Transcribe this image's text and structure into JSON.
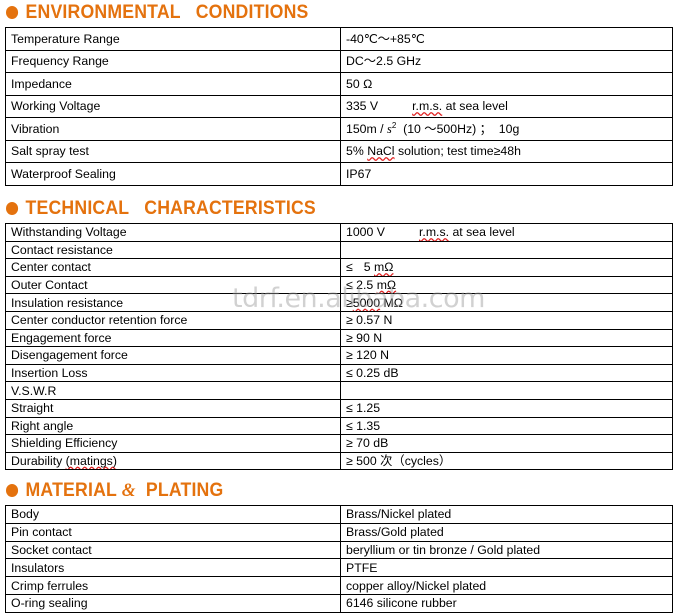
{
  "colors": {
    "accent": "#E4720E",
    "text": "#000000",
    "border": "#000000",
    "watermark": "#9b9b9b",
    "spellcheck": "#e02020"
  },
  "watermark": {
    "text": "tdrf.en.alibaba.com"
  },
  "sections": [
    {
      "id": "environmental-conditions",
      "heading": "ENVIRONMENTAL   CONDITIONS",
      "rows": [
        {
          "label": "Temperature Range",
          "value": "-40℃〜+85℃"
        },
        {
          "label": "Frequency Range",
          "value": "DC〜2.5 GHz"
        },
        {
          "label": "Impedance",
          "value": "50 Ω"
        },
        {
          "label": "Working Voltage",
          "value": "335 V"
        },
        {
          "label": "Vibration",
          "value": "150m / s2  (10 〜500Hz) ；  10g"
        },
        {
          "label": "Salt spray test",
          "value": "5% NaCl solution; test time≥48h"
        },
        {
          "label": "Waterproof Sealing",
          "value": "IP67"
        }
      ],
      "notes": {
        "working_voltage_suffix": "r.m.s. at sea level",
        "working_voltage_rms": "r.m.s.",
        "working_voltage_tail": " at sea level"
      }
    },
    {
      "id": "technical-characteristics",
      "heading": "TECHNICAL   CHARACTERISTICS",
      "rows": [
        {
          "label": "Withstanding Voltage",
          "value": "1000 V"
        },
        {
          "label": "Contact resistance",
          "value": ""
        },
        {
          "label": "Center contact",
          "value": "≤   5 mΩ"
        },
        {
          "label": "Outer Contact",
          "value": "≤ 2.5 mΩ"
        },
        {
          "label": "Insulation resistance",
          "value": "≥5000 MΩ"
        },
        {
          "label": "Center conductor retention force",
          "value": "≥ 0.57 N"
        },
        {
          "label": "Engagement force",
          "value": "≥ 90 N"
        },
        {
          "label": "Disengagement force",
          "value": "≥ 120 N"
        },
        {
          "label": "Insertion Loss",
          "value": "≤ 0.25 dB"
        },
        {
          "label": "V.S.W.R",
          "value": ""
        },
        {
          "label": "Straight",
          "value": "≤ 1.25"
        },
        {
          "label": "Right angle",
          "value": "≤ 1.35"
        },
        {
          "label": "Shielding Efficiency",
          "value": "≥ 70 dB"
        },
        {
          "label": "Durability (matings)",
          "value": "≥ 500 次（cycles）"
        }
      ],
      "notes": {
        "withstanding_voltage_rms": "r.m.s.",
        "withstanding_voltage_tail": " at sea level"
      }
    },
    {
      "id": "material-plating",
      "heading_part1": "MATERIAL ",
      "heading_amp": "&",
      "heading_part2": "  PLATING",
      "rows": [
        {
          "label": "Body",
          "value": "Brass/Nickel plated"
        },
        {
          "label": "Pin contact",
          "value": "Brass/Gold plated"
        },
        {
          "label": "Socket contact",
          "value": "beryllium or tin bronze / Gold plated"
        },
        {
          "label": "Insulators",
          "value": "PTFE"
        },
        {
          "label": "Crimp ferrules",
          "value": "copper alloy/Nickel plated"
        },
        {
          "label": "O-ring sealing",
          "value": "6146 silicone rubber"
        }
      ]
    }
  ]
}
